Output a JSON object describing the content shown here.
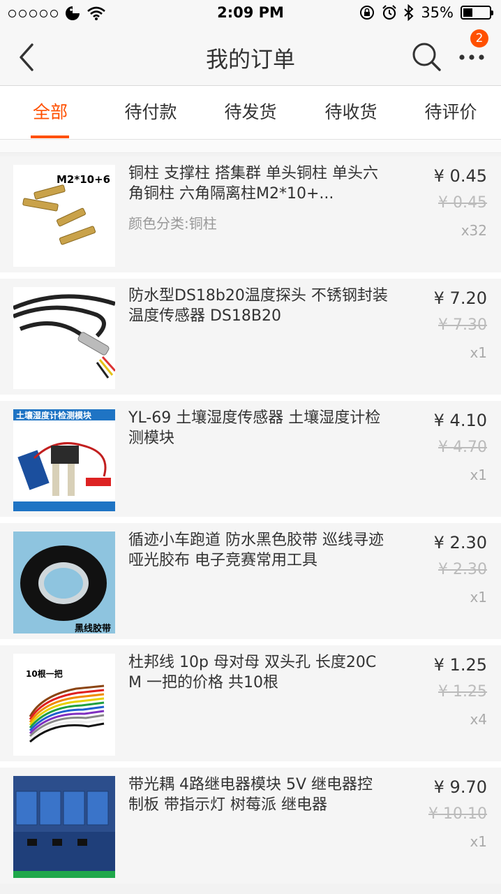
{
  "status_bar": {
    "time": "2:09 PM",
    "battery": "35%"
  },
  "nav": {
    "title": "我的订单",
    "badge_count": "2"
  },
  "tabs": [
    {
      "label": "全部",
      "active": true
    },
    {
      "label": "待付款",
      "active": false
    },
    {
      "label": "待发货",
      "active": false
    },
    {
      "label": "待收货",
      "active": false
    },
    {
      "label": "待评价",
      "active": false
    }
  ],
  "items": [
    {
      "title": "铜柱 支撑柱 搭集群 单头铜柱 单头六角铜柱 六角隔离柱M2*10+...",
      "sku": "颜色分类:铜柱",
      "price": "¥ 0.45",
      "original_price": "¥ 0.45",
      "qty": "x32",
      "image_label": "M2*10+6"
    },
    {
      "title": "防水型DS18b20温度探头 不锈钢封装 温度传感器 DS18B20",
      "sku": "",
      "price": "¥ 7.20",
      "original_price": "¥ 7.30",
      "qty": "x1",
      "image_label": ""
    },
    {
      "title": "YL-69 土壤湿度传感器 土壤湿度计检测模块",
      "sku": "",
      "price": "¥ 4.10",
      "original_price": "¥ 4.70",
      "qty": "x1",
      "image_label": "土壤湿度计检测模块"
    },
    {
      "title": "循迹小车跑道 防水黑色胶带 巡线寻迹 哑光胶布 电子竞赛常用工具",
      "sku": "",
      "price": "¥ 2.30",
      "original_price": "¥ 2.30",
      "qty": "x1",
      "image_label": "黑线胶带"
    },
    {
      "title": "杜邦线 10p 母对母 双头孔 长度20CM 一把的价格 共10根",
      "sku": "",
      "price": "¥ 1.25",
      "original_price": "¥ 1.25",
      "qty": "x4",
      "image_label": "10根一把"
    },
    {
      "title": "带光耦 4路继电器模块 5V 继电器控制板 带指示灯 树莓派 继电器",
      "sku": "",
      "price": "¥ 9.70",
      "original_price": "¥ 10.10",
      "qty": "x1",
      "image_label": ""
    }
  ]
}
